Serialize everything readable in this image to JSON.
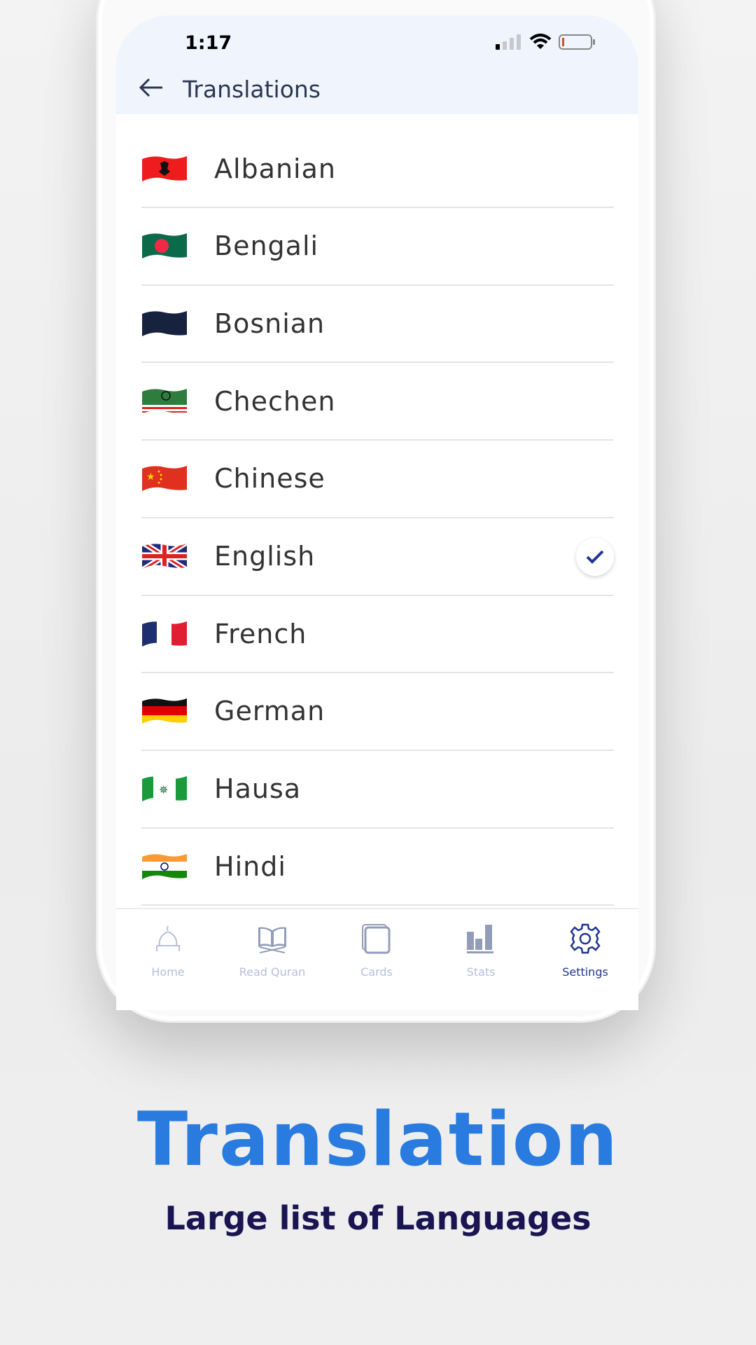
{
  "status_bar": {
    "time": "1:17"
  },
  "header": {
    "title": "Translations"
  },
  "languages": [
    {
      "name": "Albanian",
      "flag": "flag-albania",
      "selected": false
    },
    {
      "name": "Bengali",
      "flag": "flag-bangladesh",
      "selected": false
    },
    {
      "name": "Bosnian",
      "flag": "flag-bosnia",
      "selected": false
    },
    {
      "name": "Chechen",
      "flag": "flag-chechnya",
      "selected": false
    },
    {
      "name": "Chinese",
      "flag": "flag-china",
      "selected": false
    },
    {
      "name": "English",
      "flag": "flag-uk",
      "selected": true
    },
    {
      "name": "French",
      "flag": "flag-france",
      "selected": false
    },
    {
      "name": "German",
      "flag": "flag-germany",
      "selected": false
    },
    {
      "name": "Hausa",
      "flag": "flag-hausa",
      "selected": false
    },
    {
      "name": "Hindi",
      "flag": "flag-india",
      "selected": false
    }
  ],
  "tabs": [
    {
      "label": "Home",
      "icon": "mosque-icon",
      "active": false
    },
    {
      "label": "Read Quran",
      "icon": "quran-book-icon",
      "active": false
    },
    {
      "label": "Cards",
      "icon": "cards-icon",
      "active": false
    },
    {
      "label": "Stats",
      "icon": "stats-icon",
      "active": false
    },
    {
      "label": "Settings",
      "icon": "gear-icon",
      "active": true
    }
  ],
  "promo": {
    "headline": "Translation",
    "subtitle": "Large list of Languages"
  },
  "colors": {
    "accent": "#2a7be0",
    "nav_active": "#1f3591",
    "nav_inactive": "#b6bed8",
    "subtitle": "#1a1552",
    "header_bg": "#eff4fd"
  }
}
